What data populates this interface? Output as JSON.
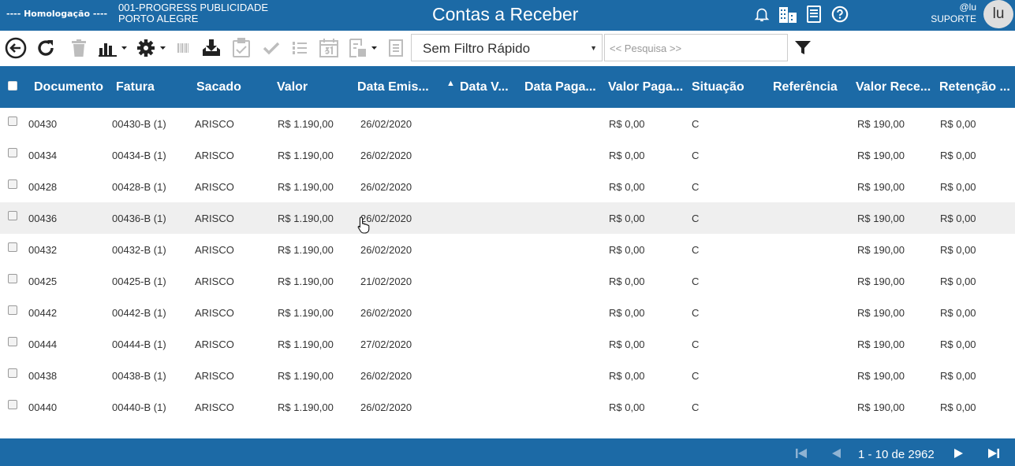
{
  "header": {
    "environment": "---- Homologação ----",
    "company_line1": "001-PROGRESS PUBLICIDADE",
    "company_line2": "PORTO ALEGRE",
    "title": "Contas a Receber",
    "user_handle": "@lu",
    "user_role": "SUPORTE",
    "avatar_initials": "lu",
    "icons": [
      "bell-icon",
      "buildings-icon",
      "document-icon",
      "help-icon"
    ]
  },
  "toolbar": {
    "icons": [
      "back-icon",
      "refresh-icon",
      "trash-icon",
      "chart-icon",
      "settings-icon",
      "barcode-icon",
      "download-icon",
      "clipboard-check-icon",
      "check-icon",
      "numbered-list-icon",
      "calendar-icon",
      "report-icon",
      "list-icon",
      "filter-icon"
    ],
    "quick_filter_value": "Sem Filtro Rápido",
    "search_placeholder": "<< Pesquisa >>"
  },
  "table": {
    "columns": [
      "Documento",
      "Fatura",
      "Sacado",
      "Valor",
      "Data Emis...",
      "Data V...",
      "Data Paga...",
      "Valor Paga...",
      "Situação",
      "Referência",
      "Valor Rece...",
      "Retenção ..."
    ],
    "rows": [
      {
        "documento": "00430",
        "fatura": "00430-B (1)",
        "sacado": "ARISCO",
        "valor": "R$ 1.190,00",
        "emissao": "26/02/2020",
        "vencimento": "",
        "pagamento": "",
        "valor_pago": "R$ 0,00",
        "situacao": "C",
        "referencia": "",
        "valor_receber": "R$ 190,00",
        "retencao": "R$ 0,00"
      },
      {
        "documento": "00434",
        "fatura": "00434-B (1)",
        "sacado": "ARISCO",
        "valor": "R$ 1.190,00",
        "emissao": "26/02/2020",
        "vencimento": "",
        "pagamento": "",
        "valor_pago": "R$ 0,00",
        "situacao": "C",
        "referencia": "",
        "valor_receber": "R$ 190,00",
        "retencao": "R$ 0,00"
      },
      {
        "documento": "00428",
        "fatura": "00428-B (1)",
        "sacado": "ARISCO",
        "valor": "R$ 1.190,00",
        "emissao": "26/02/2020",
        "vencimento": "",
        "pagamento": "",
        "valor_pago": "R$ 0,00",
        "situacao": "C",
        "referencia": "",
        "valor_receber": "R$ 190,00",
        "retencao": "R$ 0,00"
      },
      {
        "documento": "00436",
        "fatura": "00436-B (1)",
        "sacado": "ARISCO",
        "valor": "R$ 1.190,00",
        "emissao": "26/02/2020",
        "vencimento": "",
        "pagamento": "",
        "valor_pago": "R$ 0,00",
        "situacao": "C",
        "referencia": "",
        "valor_receber": "R$ 190,00",
        "retencao": "R$ 0,00"
      },
      {
        "documento": "00432",
        "fatura": "00432-B (1)",
        "sacado": "ARISCO",
        "valor": "R$ 1.190,00",
        "emissao": "26/02/2020",
        "vencimento": "",
        "pagamento": "",
        "valor_pago": "R$ 0,00",
        "situacao": "C",
        "referencia": "",
        "valor_receber": "R$ 190,00",
        "retencao": "R$ 0,00"
      },
      {
        "documento": "00425",
        "fatura": "00425-B (1)",
        "sacado": "ARISCO",
        "valor": "R$ 1.190,00",
        "emissao": "21/02/2020",
        "vencimento": "",
        "pagamento": "",
        "valor_pago": "R$ 0,00",
        "situacao": "C",
        "referencia": "",
        "valor_receber": "R$ 190,00",
        "retencao": "R$ 0,00"
      },
      {
        "documento": "00442",
        "fatura": "00442-B (1)",
        "sacado": "ARISCO",
        "valor": "R$ 1.190,00",
        "emissao": "26/02/2020",
        "vencimento": "",
        "pagamento": "",
        "valor_pago": "R$ 0,00",
        "situacao": "C",
        "referencia": "",
        "valor_receber": "R$ 190,00",
        "retencao": "R$ 0,00"
      },
      {
        "documento": "00444",
        "fatura": "00444-B (1)",
        "sacado": "ARISCO",
        "valor": "R$ 1.190,00",
        "emissao": "27/02/2020",
        "vencimento": "",
        "pagamento": "",
        "valor_pago": "R$ 0,00",
        "situacao": "C",
        "referencia": "",
        "valor_receber": "R$ 190,00",
        "retencao": "R$ 0,00"
      },
      {
        "documento": "00438",
        "fatura": "00438-B (1)",
        "sacado": "ARISCO",
        "valor": "R$ 1.190,00",
        "emissao": "26/02/2020",
        "vencimento": "",
        "pagamento": "",
        "valor_pago": "R$ 0,00",
        "situacao": "C",
        "referencia": "",
        "valor_receber": "R$ 190,00",
        "retencao": "R$ 0,00"
      },
      {
        "documento": "00440",
        "fatura": "00440-B (1)",
        "sacado": "ARISCO",
        "valor": "R$ 1.190,00",
        "emissao": "26/02/2020",
        "vencimento": "",
        "pagamento": "",
        "valor_pago": "R$ 0,00",
        "situacao": "C",
        "referencia": "",
        "valor_receber": "R$ 190,00",
        "retencao": "R$ 0,00"
      }
    ]
  },
  "pagination": {
    "range_text": "1 - 10 de 2962",
    "icons": [
      "first-page-icon",
      "previous-page-icon",
      "next-page-icon",
      "last-page-icon"
    ]
  },
  "colors": {
    "primary": "#1c6aa6",
    "row_highlight": "#efefef",
    "text": "#333333"
  }
}
